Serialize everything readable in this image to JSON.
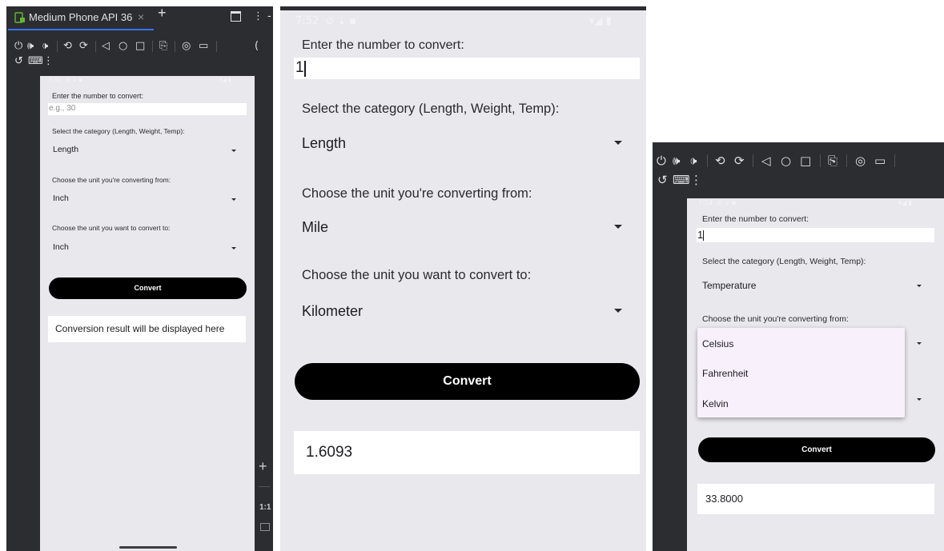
{
  "left": {
    "tab_title": "Medium Phone API 36",
    "tab_close": "×",
    "new_tab": "+",
    "status_time": "7:51",
    "input_label": "Enter the number to convert:",
    "input_placeholder": "e.g., 30",
    "category_label": "Select the category (Length, Weight, Temp):",
    "category_value": "Length",
    "from_label": "Choose the unit you're converting from:",
    "from_value": "Inch",
    "to_label": "Choose the unit you want to convert to:",
    "to_value": "Inch",
    "convert_label": "Convert",
    "result_text": "Conversion result will be displayed here",
    "zoom_plus": "+",
    "zoom_ratio": "1:1"
  },
  "middle": {
    "status_time": "7:52",
    "input_label": "Enter the number to convert:",
    "input_value": "1",
    "category_label": "Select the category (Length, Weight, Temp):",
    "category_value": "Length",
    "from_label": "Choose the unit you're converting from:",
    "from_value": "Mile",
    "to_label": "Choose the unit you want to convert to:",
    "to_value": "Kilometer",
    "convert_label": "Convert",
    "result_text": "1.6093"
  },
  "right": {
    "status_time": "7:54",
    "input_label": "Enter the number to convert:",
    "input_value": "1",
    "category_label": "Select the category (Length, Weight, Temp):",
    "category_value": "Temperature",
    "from_label": "Choose the unit you're converting from:",
    "menu_options": [
      "Celsius",
      "Fahrenheit",
      "Kelvin"
    ],
    "convert_label": "Convert",
    "result_text": "33.8000"
  },
  "icons": [
    "power-icon",
    "volume-up-icon",
    "volume-down-icon",
    "rotate-left-icon",
    "rotate-right-icon",
    "back-icon",
    "home-icon",
    "overview-icon",
    "screenshot-device-icon",
    "camera-icon",
    "record-icon",
    "fold-icon",
    "keyboard-icon",
    "more-icon"
  ],
  "colors": {
    "toolbar_bg": "#2b2d30",
    "phone_bg": "#e9e8ed",
    "accent": "#3574f0",
    "button": "#000000",
    "menu_bg": "#f8f0fb"
  }
}
